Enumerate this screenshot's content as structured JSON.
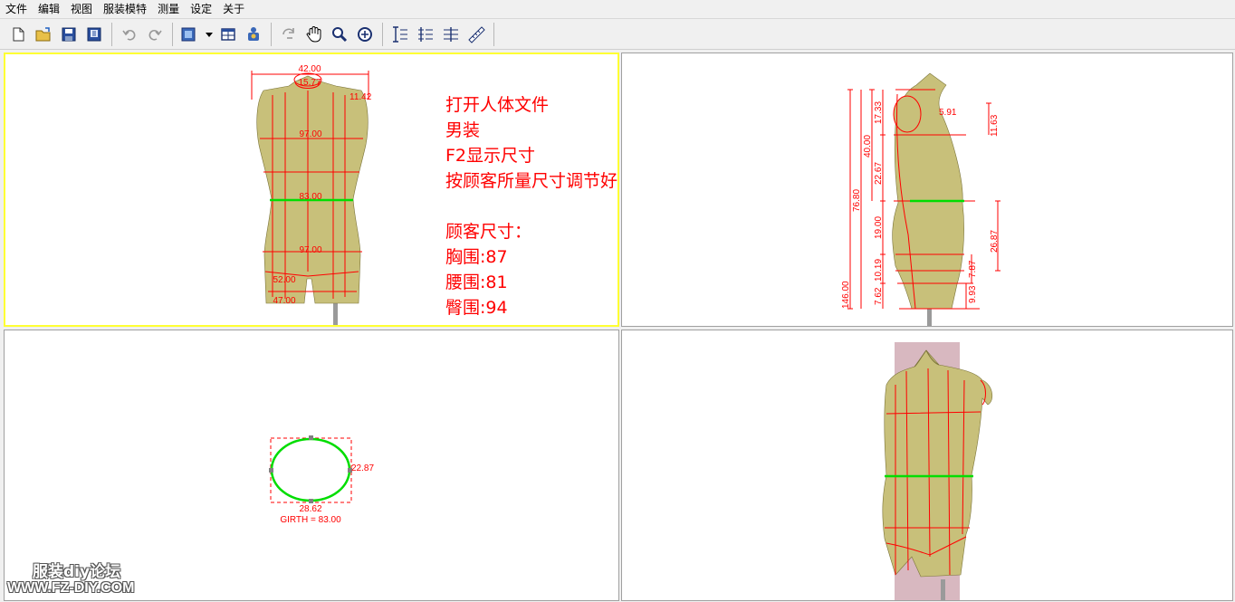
{
  "menu": [
    "文件",
    "编辑",
    "视图",
    "服装模特",
    "测量",
    "设定",
    "关于"
  ],
  "toolbar": {
    "icons": [
      "new-file-icon",
      "open-folder-icon",
      "save-icon",
      "save-all-icon",
      "undo-icon",
      "redo-icon",
      "mannequin-icon",
      "layout-icon",
      "camera-icon",
      "rotate-icon",
      "hand-icon",
      "zoom-icon",
      "fit-icon",
      "measure-vertical-icon",
      "measure-list-icon",
      "measure-grid-icon",
      "ruler-icon"
    ]
  },
  "front_view": {
    "dims": {
      "shoulder": "42.00",
      "neck": "15.77",
      "armhole": "11.42",
      "chest": "97.00",
      "waist": "83.00",
      "hip": "97.00",
      "thigh": "52.00",
      "knee": "47.00"
    },
    "notes": [
      "打开人体文件",
      "男装",
      "F2显示尺寸",
      "按顾客所量尺寸调节好",
      "",
      "顾客尺寸：",
      "胸围:87",
      "腰围:81",
      "臀围:94"
    ]
  },
  "side_view": {
    "dims": {
      "total": "146.00",
      "torso": "76.80",
      "upper": "40.00",
      "neck_bust": "17.33",
      "bust_waist": "22.67",
      "waist_hip": "19.00",
      "hip_crotch": "10.19",
      "crotch_low": "7.62",
      "arm": "5.91",
      "right_upper": "11.63",
      "right_mid": "26.87",
      "right_low": "7.87",
      "right_bottom": "9.93"
    }
  },
  "section_view": {
    "width": "28.62",
    "depth": "22.87",
    "girth": "GIRTH = 83.00"
  },
  "watermark": {
    "line1": "服装diy论坛",
    "line2": "WWW.FZ-DIY.COM"
  },
  "colors": {
    "accent": "#ff0000",
    "waist_line": "#00dd00",
    "active_view": "#ffff33",
    "skin": "#c8c07a"
  }
}
